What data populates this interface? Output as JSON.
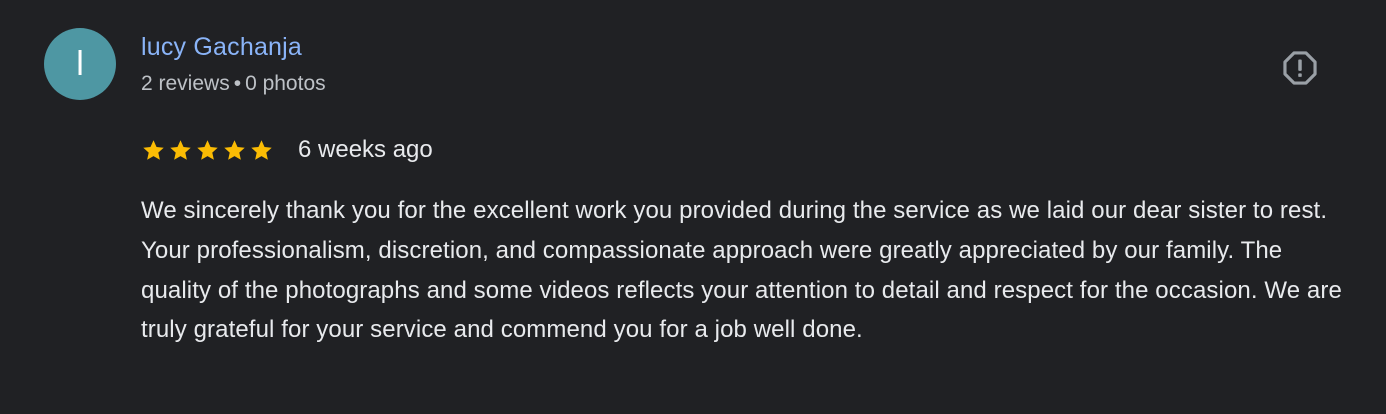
{
  "reviewer": {
    "initial": "l",
    "avatar_color": "#4e97a3",
    "name": "lucy Gachanja",
    "reviews_count": "2 reviews",
    "separator": "•",
    "photos_count": "0 photos"
  },
  "report": {
    "icon": "report-octagon-icon"
  },
  "rating": {
    "stars": 5,
    "max_stars": 5,
    "star_color": "#fbbc04",
    "time_ago": "6 weeks ago"
  },
  "review": {
    "text": "We sincerely thank you for the excellent work you provided during the service as we laid our dear sister to rest. Your professionalism, discretion, and compassionate approach were greatly appreciated by our family. The quality of the photographs and some videos reflects your attention to detail and respect for the occasion. We are truly grateful for your service and commend you for a job well done."
  },
  "colors": {
    "background": "#202124",
    "name_link": "#8ab4f8",
    "meta_text": "#bdc1c6",
    "body_text": "#e8eaed",
    "report_icon": "#9aa0a6"
  }
}
